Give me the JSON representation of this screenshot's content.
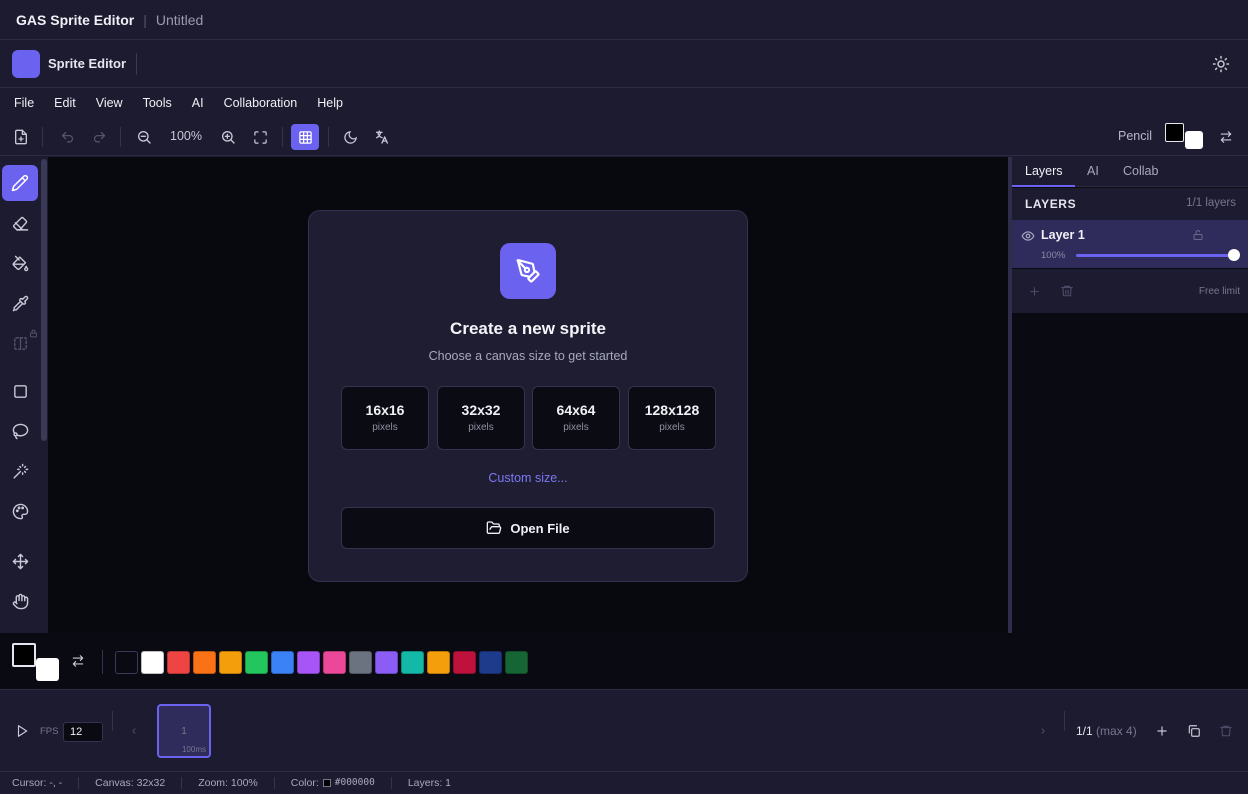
{
  "window": {
    "app_title": "GAS Sprite Editor",
    "separator": "|",
    "document": "Untitled"
  },
  "header": {
    "name": "Sprite Editor",
    "accent": "#6b63f0"
  },
  "menu": [
    "File",
    "Edit",
    "View",
    "Tools",
    "AI",
    "Collaboration",
    "Help"
  ],
  "toolbar": {
    "zoom": "100%",
    "current_tool": "Pencil",
    "primary_color": "#000000",
    "secondary_color": "#ffffff"
  },
  "welcome": {
    "title": "Create a new sprite",
    "subtitle": "Choose a canvas size to get started",
    "sizes": [
      {
        "value": "16x16",
        "unit": "pixels"
      },
      {
        "value": "32x32",
        "unit": "pixels"
      },
      {
        "value": "64x64",
        "unit": "pixels"
      },
      {
        "value": "128x128",
        "unit": "pixels"
      }
    ],
    "custom": "Custom size...",
    "open_file": "Open File"
  },
  "right_panel": {
    "tabs": [
      "Layers",
      "AI",
      "Collab"
    ],
    "active_tab": "Layers",
    "layers_title": "LAYERS",
    "layer_count": "1/1 layers",
    "layers": [
      {
        "name": "Layer 1",
        "opacity_label": "100%",
        "opacity": 100,
        "visible": true,
        "locked": false
      }
    ],
    "free_limit": "Free limit"
  },
  "palette": [
    "#0a0a12",
    "#ffffff",
    "#ef4444",
    "#f97316",
    "#f59e0b",
    "#22c55e",
    "#3b82f6",
    "#a855f7",
    "#ec4899",
    "#6b7280",
    "#8b5cf6",
    "#14b8a6",
    "#f59e0b",
    "#be123c",
    "#1e3a8a",
    "#166534"
  ],
  "timeline": {
    "fps_label": "FPS",
    "fps": "12",
    "frames": [
      {
        "number": "1",
        "duration": "100ms"
      }
    ],
    "frame_count": "1/1",
    "frame_max": "(max 4)"
  },
  "status": {
    "cursor": "Cursor: -, -",
    "canvas": "Canvas: 32x32",
    "zoom": "Zoom: 100%",
    "color_label": "Color:",
    "color_value": "#000000",
    "layers": "Layers: 1"
  }
}
